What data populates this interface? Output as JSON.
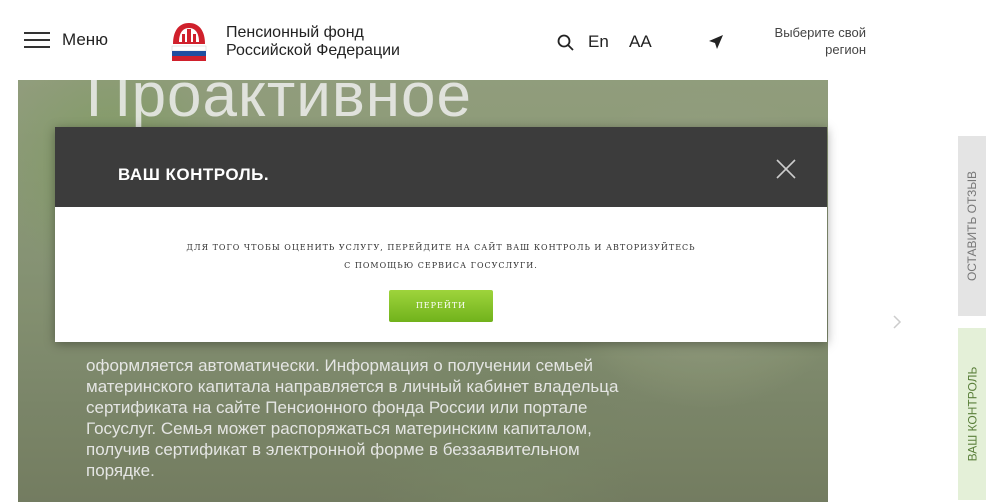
{
  "header": {
    "menu_label": "Меню",
    "org_line1": "Пенсионный фонд",
    "org_line2": "Российской Федерации",
    "lang_label": "En",
    "font_size_label": "AA",
    "region_line1": "Выберите свой",
    "region_line2": "регион"
  },
  "hero": {
    "title": "Проактивное",
    "text_lines": [
      "оформляется автоматически. Информация о получении семьей",
      "материнского капитала направляется в личный кабинет владельца",
      "сертификата на сайте Пенсионного фонда России или портале",
      "Госуслуг. Семья может распоряжаться материнским капиталом,",
      "получив сертификат в электронной форме в беззаявительном",
      "порядке."
    ]
  },
  "modal": {
    "title": "ВАШ КОНТРОЛЬ.",
    "text_line1": "ДЛЯ ТОГО ЧТОБЫ ОЦЕНИТЬ УСЛУГУ, ПЕРЕЙДИТЕ НА САЙТ ВАШ КОНТРОЛЬ И АВТОРИЗУЙТЕСЬ",
    "text_line2": "С ПОМОЩЬЮ СЕРВИСА ГОСУСЛУГИ.",
    "button_label": "ПЕРЕЙТИ"
  },
  "side_tabs": {
    "review": "ОСТАВИТЬ ОТЗЫВ",
    "control": "ВАШ КОНТРОЛЬ"
  },
  "colors": {
    "modal_header": "#3c3c3c",
    "button_green": "#7fbf24",
    "logo_red": "#d0202c",
    "logo_blue": "#1f4fa0"
  },
  "icons": [
    "menu-icon",
    "pfr-logo",
    "search-icon",
    "location-arrow-icon",
    "close-icon",
    "chevron-right-icon"
  ]
}
